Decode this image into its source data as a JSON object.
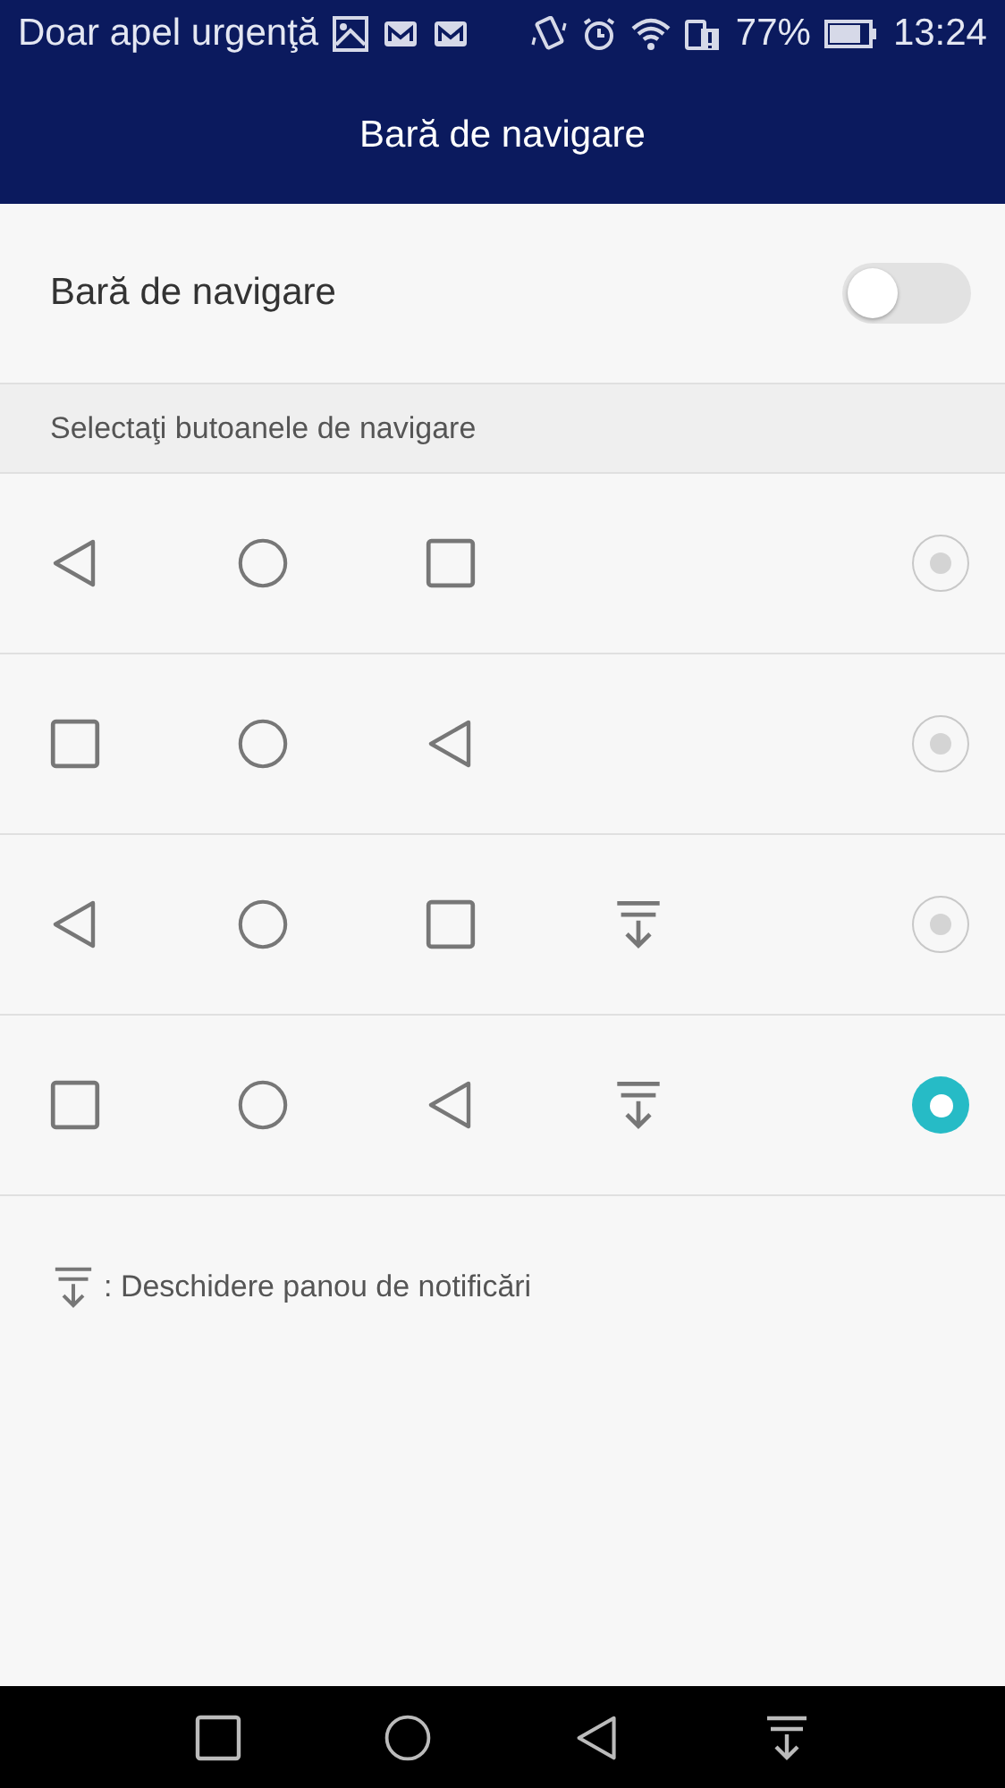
{
  "status_bar": {
    "notice": "Doar apel urgenţă",
    "battery_percent": "77%",
    "time": "13:24"
  },
  "header": {
    "title": "Bară de navigare"
  },
  "toggle": {
    "label": "Bară de navigare",
    "on": false
  },
  "section_label": "Selectaţi butoanele de navigare",
  "options": [
    {
      "buttons": [
        {
          "kind": "back"
        },
        {
          "kind": "home"
        },
        {
          "kind": "recent"
        }
      ],
      "selected": false
    },
    {
      "buttons": [
        {
          "kind": "recent"
        },
        {
          "kind": "home"
        },
        {
          "kind": "back"
        }
      ],
      "selected": false
    },
    {
      "buttons": [
        {
          "kind": "back"
        },
        {
          "kind": "home"
        },
        {
          "kind": "recent"
        },
        {
          "kind": "notify"
        }
      ],
      "selected": false
    },
    {
      "buttons": [
        {
          "kind": "recent"
        },
        {
          "kind": "home"
        },
        {
          "kind": "back"
        },
        {
          "kind": "notify"
        }
      ],
      "selected": true
    }
  ],
  "note": {
    "text": ": Deschidere panou de notificări"
  },
  "system_nav": [
    {
      "kind": "recent"
    },
    {
      "kind": "home"
    },
    {
      "kind": "back"
    },
    {
      "kind": "notify"
    }
  ]
}
